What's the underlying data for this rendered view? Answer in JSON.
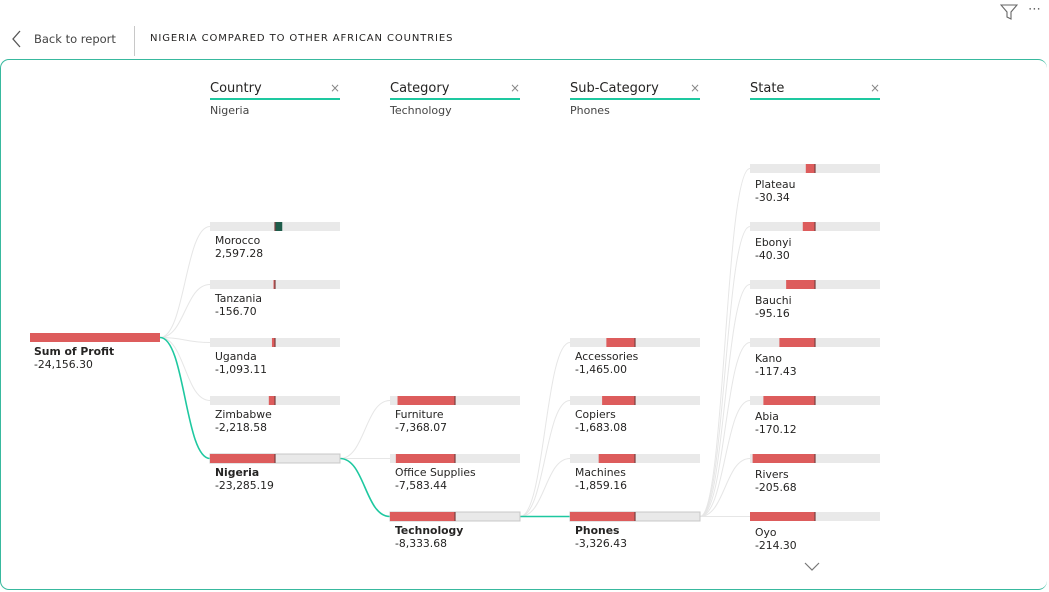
{
  "header": {
    "back_label": "Back to report",
    "page_title": "NIGERIA COMPARED TO OTHER AFRICAN COUNTRIES",
    "filter_icon": "filter-icon",
    "more_icon": "more-options-icon"
  },
  "colors": {
    "negative_bar": "#dd5c5c",
    "positive_bar": "#1e5c4a",
    "bar_background": "#e9e9e9",
    "selected_path": "#1ec8a0",
    "unselected_path": "#e6e6e6",
    "accent": "#1ec8a0"
  },
  "chart_data": {
    "type": "decomposition-tree",
    "measure": "Sum of Profit",
    "root": {
      "label": "Sum of Profit",
      "value_text": "-24,156.30",
      "value": -24156.3
    },
    "levels": [
      {
        "field": "Country",
        "selected": "Nigeria",
        "nodes": [
          {
            "label": "Morocco",
            "value_text": "2,597.28",
            "value": 2597.28
          },
          {
            "label": "Tanzania",
            "value_text": "-156.70",
            "value": -156.7
          },
          {
            "label": "Uganda",
            "value_text": "-1,093.11",
            "value": -1093.11
          },
          {
            "label": "Zimbabwe",
            "value_text": "-2,218.58",
            "value": -2218.58
          },
          {
            "label": "Nigeria",
            "value_text": "-23,285.19",
            "value": -23285.19
          }
        ]
      },
      {
        "field": "Category",
        "selected": "Technology",
        "nodes": [
          {
            "label": "Furniture",
            "value_text": "-7,368.07",
            "value": -7368.07
          },
          {
            "label": "Office Supplies",
            "value_text": "-7,583.44",
            "value": -7583.44
          },
          {
            "label": "Technology",
            "value_text": "-8,333.68",
            "value": -8333.68
          }
        ]
      },
      {
        "field": "Sub-Category",
        "selected": "Phones",
        "nodes": [
          {
            "label": "Accessories",
            "value_text": "-1,465.00",
            "value": -1465.0
          },
          {
            "label": "Copiers",
            "value_text": "-1,683.08",
            "value": -1683.08
          },
          {
            "label": "Machines",
            "value_text": "-1,859.16",
            "value": -1859.16
          },
          {
            "label": "Phones",
            "value_text": "-3,326.43",
            "value": -3326.43
          }
        ]
      },
      {
        "field": "State",
        "selected": "",
        "nodes": [
          {
            "label": "Plateau",
            "value_text": "-30.34",
            "value": -30.34
          },
          {
            "label": "Ebonyi",
            "value_text": "-40.30",
            "value": -40.3
          },
          {
            "label": "Bauchi",
            "value_text": "-95.16",
            "value": -95.16
          },
          {
            "label": "Kano",
            "value_text": "-117.43",
            "value": -117.43
          },
          {
            "label": "Abia",
            "value_text": "-170.12",
            "value": -170.12
          },
          {
            "label": "Rivers",
            "value_text": "-205.68",
            "value": -205.68
          },
          {
            "label": "Oyo",
            "value_text": "-214.30",
            "value": -214.3
          }
        ]
      }
    ]
  }
}
